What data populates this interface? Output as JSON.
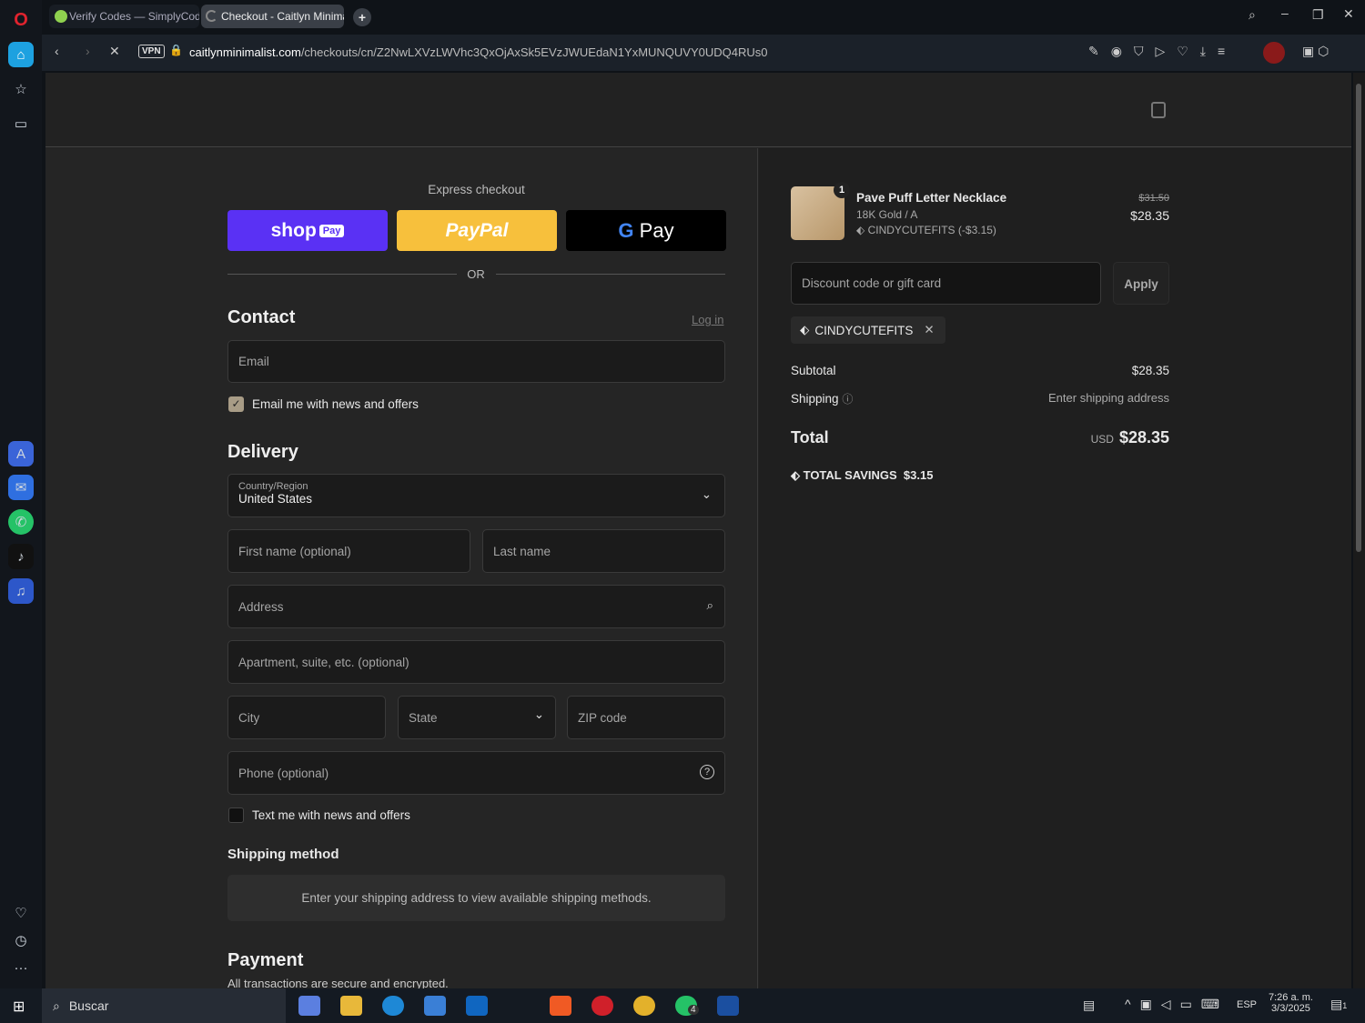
{
  "browser": {
    "tabs": [
      {
        "label": "Verify Codes — SimplyCodes"
      },
      {
        "label": "Checkout - Caitlyn Minimalist"
      }
    ],
    "url_domain": "caitlynminimalist.com",
    "url_path": "/checkouts/cn/Z2NwLXVzLWVhc3QxOjAxSk5EVzJWUEdaN1YxMUNQUVY0UDQ4RUs0",
    "vpn": "VPN"
  },
  "express": {
    "title": "Express checkout",
    "shop": "shop",
    "shop_pay": "Pay",
    "paypal": "PayPal",
    "gpay": "Pay",
    "or": "OR"
  },
  "contact": {
    "title": "Contact",
    "login": "Log in",
    "email_placeholder": "Email",
    "news_label": "Email me with news and offers",
    "news_checked": true
  },
  "delivery": {
    "title": "Delivery",
    "country_label": "Country/Region",
    "country_value": "United States",
    "first_name": "First name (optional)",
    "last_name": "Last name",
    "address": "Address",
    "apartment": "Apartment, suite, etc. (optional)",
    "city": "City",
    "state": "State",
    "zip": "ZIP code",
    "phone": "Phone (optional)",
    "text_label": "Text me with news and offers"
  },
  "shipping_method": {
    "title": "Shipping method",
    "message": "Enter your shipping address to view available shipping methods."
  },
  "payment": {
    "title": "Payment",
    "subtitle": "All transactions are secure and encrypted."
  },
  "summary": {
    "product": {
      "name": "Pave Puff Letter Necklace",
      "variant": "18K Gold / A",
      "discount": "CINDYCUTEFITS (-$3.15)",
      "qty": "1",
      "original_price": "$31.50",
      "price": "$28.35"
    },
    "discount_placeholder": "Discount code or gift card",
    "apply": "Apply",
    "applied_code": "CINDYCUTEFITS",
    "subtotal_label": "Subtotal",
    "subtotal": "$28.35",
    "shipping_label": "Shipping",
    "shipping_value": "Enter shipping address",
    "total_label": "Total",
    "currency": "USD",
    "total": "$28.35",
    "savings_label": "TOTAL SAVINGS",
    "savings": "$3.15"
  },
  "taskbar": {
    "search": "Buscar",
    "lang": "ESP",
    "time": "7:26 a. m.",
    "date": "3/3/2025",
    "whatsapp_badge": "4",
    "notif_badge": "1"
  }
}
